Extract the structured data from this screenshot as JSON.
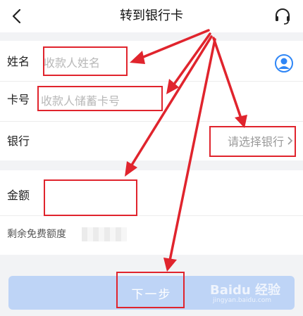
{
  "header": {
    "title": "转到银行卡",
    "back_icon": "chevron-left-icon",
    "support_icon": "headset-icon"
  },
  "form": {
    "name_label": "姓名",
    "name_placeholder": "收款人姓名",
    "card_label": "卡号",
    "card_placeholder": "收款人储蓄卡号",
    "bank_label": "银行",
    "bank_select_text": "请选择银行",
    "amount_label": "金额",
    "amount_value": ""
  },
  "quota": {
    "label": "剩余免费额度"
  },
  "footer": {
    "next_button_label": "下一步"
  },
  "watermark": {
    "brand": "Baidu 经验",
    "url": "jingyan.baidu.com"
  },
  "colors": {
    "annotation_red": "#e0242d",
    "button_bg": "#bed4f6",
    "contact_icon_blue": "#2f86f6"
  }
}
